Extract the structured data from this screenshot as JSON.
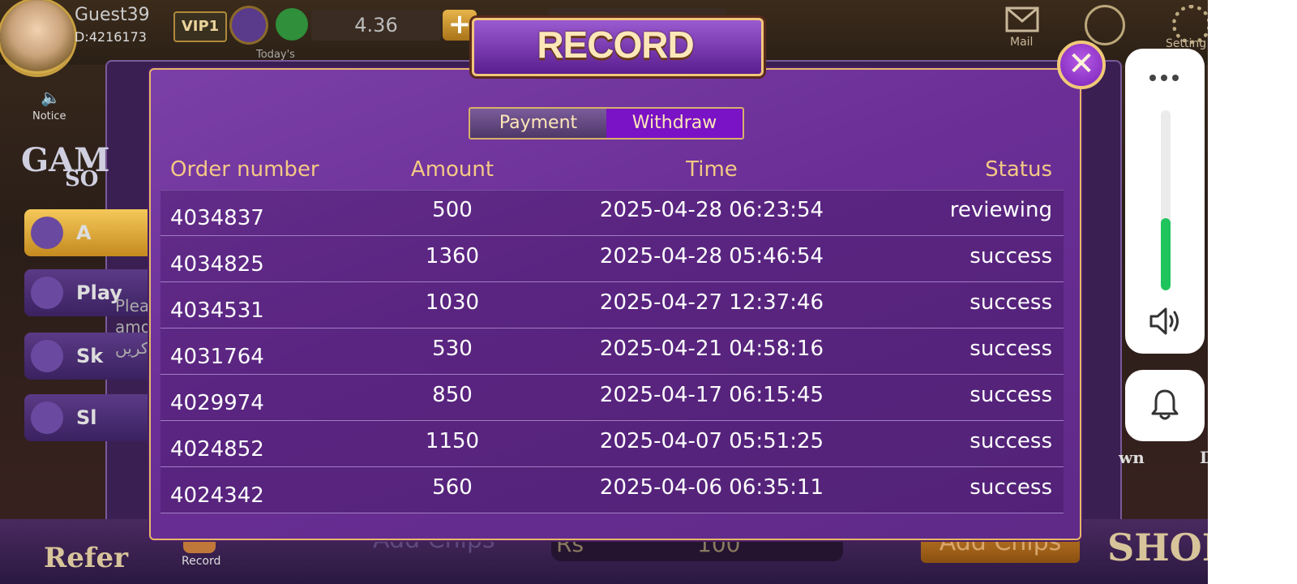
{
  "header": {
    "guest_name": "Guest39",
    "guest_id": "D:4216173",
    "vip_label": "VIP1",
    "balance": "4.36",
    "add_label": "+",
    "todays_label": "Today's",
    "mail_label": "Mail",
    "setting_label": "Setting"
  },
  "sidebar": {
    "notice_label": "Notice",
    "logo_text_1": "GAM",
    "logo_text_2": "SO",
    "items": [
      {
        "label": "A",
        "icon": "gamepad-icon"
      },
      {
        "label": "Play",
        "icon": "mask-icon"
      },
      {
        "label": "Sk",
        "icon": "cards-icon"
      },
      {
        "label": "Sl",
        "icon": "slots-icon"
      }
    ],
    "please_text_1": "Plea",
    "please_text_2": "amo",
    "please_text_3": "کریں"
  },
  "bottom": {
    "refer_label": "Refer",
    "record_label": "Record",
    "add_chips_label": "Add Chips",
    "rs_label": "Rs",
    "rs_value": "100",
    "add_chips_button": "Add Chips",
    "shop_label": "SHOP",
    "dir_label": "Dire",
    "wn_label": "wn"
  },
  "modal": {
    "title": "RECORD",
    "close_label": "✕",
    "tabs": [
      {
        "label": "Payment",
        "active": false
      },
      {
        "label": "Withdraw",
        "active": true
      }
    ],
    "columns": {
      "order": "Order number",
      "amount": "Amount",
      "time": "Time",
      "status": "Status"
    },
    "rows": [
      {
        "order": "4034837",
        "amount": "500",
        "time": "2025-04-28 06:23:54",
        "status": "reviewing"
      },
      {
        "order": "4034825",
        "amount": "1360",
        "time": "2025-04-28 05:46:54",
        "status": "success"
      },
      {
        "order": "4034531",
        "amount": "1030",
        "time": "2025-04-27 12:37:46",
        "status": "success"
      },
      {
        "order": "4031764",
        "amount": "530",
        "time": "2025-04-21 04:58:16",
        "status": "success"
      },
      {
        "order": "4029974",
        "amount": "850",
        "time": "2025-04-17 06:15:45",
        "status": "success"
      },
      {
        "order": "4024852",
        "amount": "1150",
        "time": "2025-04-07 05:51:25",
        "status": "success"
      },
      {
        "order": "4024342",
        "amount": "560",
        "time": "2025-04-06 06:35:11",
        "status": "success"
      }
    ]
  },
  "volume_overlay": {
    "level_fraction": 0.4,
    "fill_color": "#1fc45c",
    "more_icon": "more-dots-icon",
    "speaker_icon": "speaker-icon",
    "bell_icon": "bell-icon"
  },
  "colors": {
    "modal_purple": "#6a2e96",
    "gold_border": "#e6b86a",
    "header_text": "#f4c985",
    "active_tab": "#7a12c6"
  }
}
